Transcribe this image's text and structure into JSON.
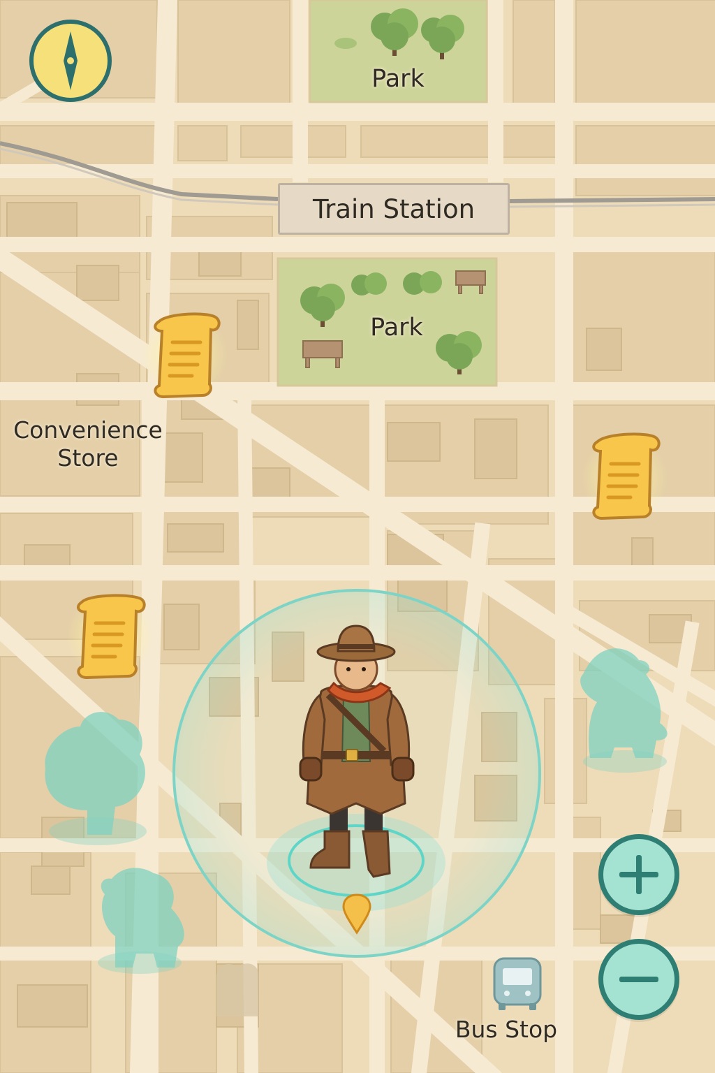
{
  "map": {
    "labels": {
      "park_top": "Park",
      "park_mid": "Park",
      "train_station": "Train Station",
      "convenience_line1": "Convenience",
      "convenience_line2": "Store",
      "bus_stop": "Bus Stop"
    }
  },
  "controls": {
    "zoom_in": "+",
    "zoom_out": "−"
  },
  "player": {
    "character": "explorer-with-hat"
  },
  "collectibles": [
    "scroll",
    "scroll",
    "scroll"
  ],
  "creatures": [
    "dinosaur",
    "tree",
    "elephant"
  ],
  "icons": {
    "compass": "compass-icon",
    "bus": "bus-icon",
    "scroll": "scroll-icon",
    "pin": "location-pin-icon"
  },
  "colors": {
    "map_bg": "#eedcb8",
    "road": "#f6ead2",
    "block": "#e4cfa8",
    "park": "#cdd49a",
    "accent_teal": "#2e7e74",
    "button_fill": "#a4e2d2",
    "scroll_gold": "#f5c04a",
    "compass_fill": "#f6e07a",
    "creature_silhouette": "#7fd2c0"
  }
}
